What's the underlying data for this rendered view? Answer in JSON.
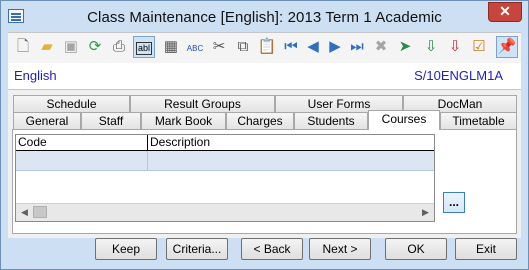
{
  "window": {
    "title": "Class Maintenance  [English]: 2013 Term 1 Academic"
  },
  "info": {
    "subject": "English",
    "class_code": "S/10ENGLM1A"
  },
  "tabs_row1": [
    "Schedule",
    "Result Groups",
    "User Forms",
    "DocMan"
  ],
  "tabs_row2": [
    "General",
    "Staff",
    "Mark Book",
    "Charges",
    "Students",
    "Courses",
    "Timetable"
  ],
  "selected_tab": "Courses",
  "grid": {
    "columns": [
      "Code",
      "Description"
    ],
    "rows": [
      [
        "",
        ""
      ]
    ]
  },
  "ellipsis_label": "...",
  "buttons": [
    "Keep",
    "Criteria...",
    "< Back",
    "Next >",
    "OK",
    "Exit"
  ],
  "toolbar_icons": [
    "new-icon",
    "open-folder-icon",
    "save-icon",
    "refresh-icon",
    "print-icon",
    "text-field-icon",
    "calculator-icon",
    "spell-check-icon",
    "cut-icon",
    "copy-icon",
    "paste-icon",
    "first-record-icon",
    "previous-record-icon",
    "next-record-icon",
    "last-record-icon",
    "delete-icon",
    "find-icon",
    "import-icon",
    "export-icon",
    "checklist-icon",
    "pin-icon"
  ]
}
